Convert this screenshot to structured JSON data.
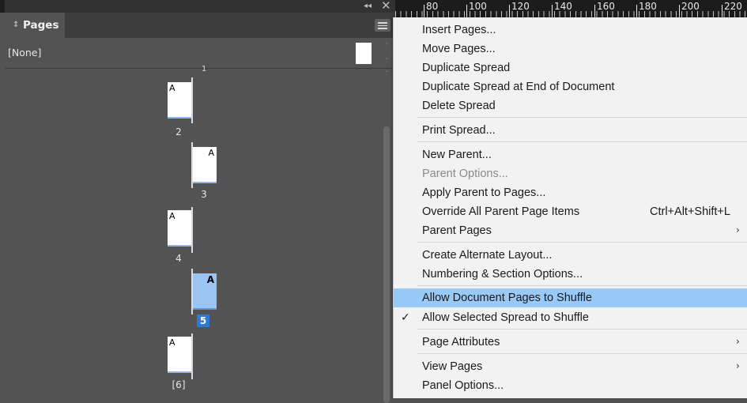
{
  "panel": {
    "title": "Pages",
    "tab_chevron": "⇕",
    "collapse_glyph": "◂◂",
    "close_glyph": "✕",
    "parent_none": "[None]",
    "pages": [
      {
        "number": "2",
        "marker": "A",
        "side": "left",
        "selected": false
      },
      {
        "number": "3",
        "marker": "A",
        "side": "right",
        "selected": false
      },
      {
        "number": "4",
        "marker": "A",
        "side": "left",
        "selected": false
      },
      {
        "number": "5",
        "marker": "A",
        "side": "right",
        "selected": true
      },
      {
        "number": "[6]",
        "marker": "A",
        "side": "left",
        "selected": false
      }
    ],
    "top_tick": "1"
  },
  "ruler": {
    "labels": [
      "80",
      "100",
      "120",
      "140",
      "160",
      "180",
      "200",
      "220"
    ]
  },
  "menu": {
    "items": [
      {
        "label": "Insert Pages...",
        "disabled": false
      },
      {
        "label": "Move Pages...",
        "disabled": false
      },
      {
        "label": "Duplicate Spread",
        "disabled": false
      },
      {
        "label": "Duplicate Spread at End of Document",
        "disabled": false
      },
      {
        "label": "Delete Spread",
        "disabled": false
      },
      {
        "label": "Print Spread...",
        "disabled": false
      },
      {
        "label": "New Parent...",
        "disabled": false
      },
      {
        "label": "Parent Options...",
        "disabled": true
      },
      {
        "label": "Apply Parent to Pages...",
        "disabled": false
      },
      {
        "label": "Override All Parent Page Items",
        "shortcut": "Ctrl+Alt+Shift+L",
        "disabled": false
      },
      {
        "label": "Parent Pages",
        "submenu": true,
        "disabled": false
      },
      {
        "label": "Create Alternate Layout...",
        "disabled": false
      },
      {
        "label": "Numbering & Section Options...",
        "disabled": false
      },
      {
        "label": "Allow Document Pages to Shuffle",
        "highlighted": true,
        "disabled": false
      },
      {
        "label": "Allow Selected Spread to Shuffle",
        "checked": true,
        "disabled": false
      },
      {
        "label": "Page Attributes",
        "submenu": true,
        "disabled": false
      },
      {
        "label": "View Pages",
        "submenu": true,
        "disabled": false
      },
      {
        "label": "Panel Options...",
        "disabled": false
      }
    ],
    "submenu_glyph": "›",
    "check_glyph": "✓"
  },
  "colors": {
    "panel_bg": "#535353",
    "menu_bg": "#f2f2f2",
    "highlight": "#99c9f7",
    "selected_page": "#9cc4f3",
    "selected_number": "#2f7ad6"
  }
}
